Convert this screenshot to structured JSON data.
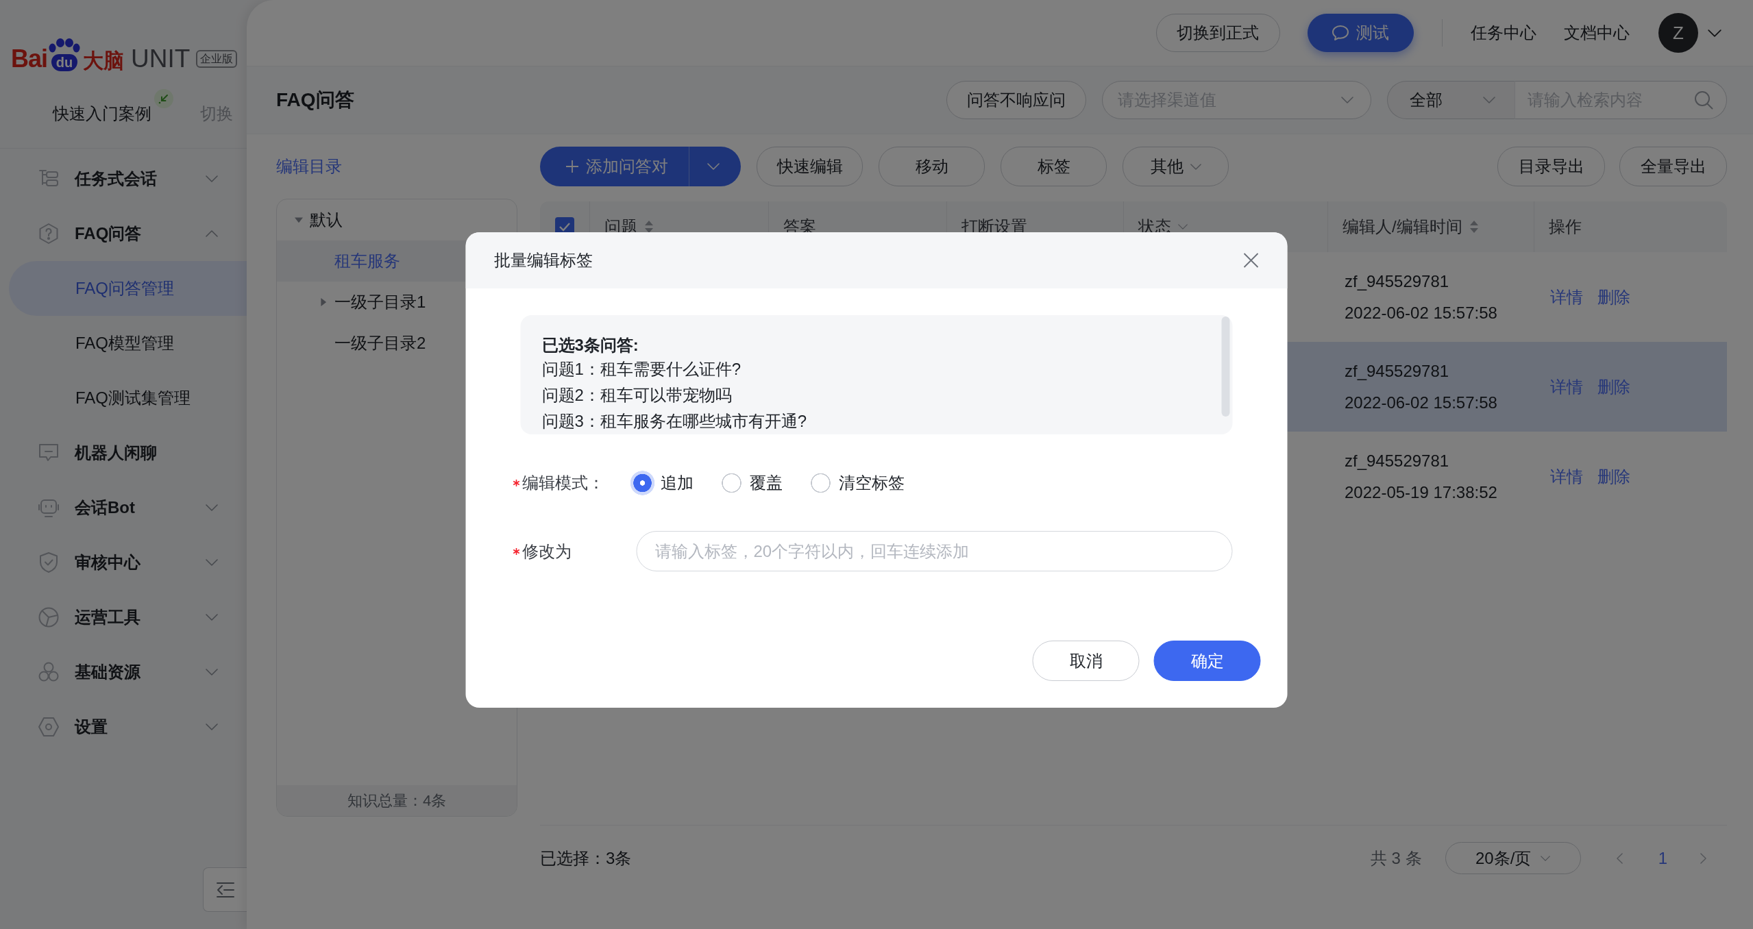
{
  "sidebar": {
    "logo": {
      "brand": "Bai",
      "paw": "du",
      "brain": "大脑",
      "product": "UNIT",
      "edition": "企业版"
    },
    "quick_start": {
      "label": "快速入门案例",
      "switch": "切换"
    },
    "menu": [
      {
        "label": "任务式会话",
        "kind": "group",
        "expanded": false,
        "selected": false
      },
      {
        "label": "FAQ问答",
        "kind": "group",
        "expanded": true,
        "selected": false,
        "children": [
          {
            "label": "FAQ问答管理",
            "selected": true
          },
          {
            "label": "FAQ模型管理",
            "selected": false
          },
          {
            "label": "FAQ测试集管理",
            "selected": false
          }
        ]
      },
      {
        "label": "机器人闲聊",
        "kind": "link",
        "selected": false
      },
      {
        "label": "会话Bot",
        "kind": "group",
        "expanded": false,
        "selected": false
      },
      {
        "label": "审核中心",
        "kind": "group",
        "expanded": false,
        "selected": false
      },
      {
        "label": "运营工具",
        "kind": "group",
        "expanded": false,
        "selected": false
      },
      {
        "label": "基础资源",
        "kind": "group",
        "expanded": false,
        "selected": false
      },
      {
        "label": "设置",
        "kind": "group",
        "expanded": false,
        "selected": false
      }
    ]
  },
  "top_bar": {
    "switch_button": "切换到正式",
    "test_button": "测试",
    "links": [
      "任务中心",
      "文档中心"
    ],
    "avatar": "Z"
  },
  "page_header": {
    "title": "FAQ问答",
    "no_response_button": "问答不响应问",
    "channel_select": {
      "placeholder": "请选择渠道值"
    },
    "search": {
      "scope": "全部",
      "placeholder": "请输入检索内容"
    }
  },
  "toolbar": {
    "edit_catalog_link": "编辑目录",
    "add_button": "添加问答对",
    "buttons": [
      {
        "label": "快速编辑",
        "kind": "plain"
      },
      {
        "label": "移动",
        "kind": "plain"
      },
      {
        "label": "标签",
        "kind": "plain"
      },
      {
        "label": "其他",
        "kind": "dropdown"
      }
    ],
    "export_buttons": [
      "目录导出",
      "全量导出"
    ]
  },
  "tree": {
    "items": [
      {
        "label": "默认",
        "expanded": true,
        "selected": false,
        "children": [
          {
            "label": "租车服务",
            "selected": true
          },
          {
            "label": "一级子目录1",
            "expanded": false,
            "selected": false
          },
          {
            "label": "一级子目录2",
            "selected": false
          }
        ]
      }
    ],
    "footer": "知识总量：4条"
  },
  "table": {
    "all_checked": true,
    "columns": [
      {
        "label": "问题",
        "kind": "sort"
      },
      {
        "label": "答案",
        "kind": "plain"
      },
      {
        "label": "打断设置",
        "kind": "plain"
      },
      {
        "label": "状态",
        "kind": "filter"
      },
      {
        "label": "编辑人/编辑时间",
        "kind": "sort"
      },
      {
        "label": "操作",
        "kind": "plain"
      }
    ],
    "rows": [
      {
        "highlighted": false,
        "editor": "zf_945529781",
        "edited_at": "2022-06-02 15:57:58",
        "actions": [
          "详情",
          "删除"
        ]
      },
      {
        "highlighted": true,
        "editor": "zf_945529781",
        "edited_at": "2022-06-02 15:57:58",
        "actions": [
          "详情",
          "删除"
        ]
      },
      {
        "highlighted": false,
        "editor": "zf_945529781",
        "edited_at": "2022-05-19 17:38:52",
        "actions": [
          "详情",
          "删除"
        ]
      }
    ]
  },
  "footer": {
    "selected_count": "已选择：3条",
    "total": "共 3 条",
    "page_size": "20条/页",
    "pages": [
      {
        "label": "1",
        "selected": true
      }
    ]
  },
  "modal": {
    "title": "批量编辑标签",
    "summary": {
      "heading": "已选3条问答:",
      "lines": [
        "问题1：租车需要什么证件?",
        "问题2：租车可以带宠物吗",
        "问题3：租车服务在哪些城市有开通?"
      ]
    },
    "mode": {
      "label": "编辑模式：",
      "required": true,
      "options": [
        {
          "label": "追加",
          "selected": true
        },
        {
          "label": "覆盖",
          "selected": false
        },
        {
          "label": "清空标签",
          "selected": false
        }
      ]
    },
    "tags_field": {
      "label": "修改为",
      "required": true,
      "placeholder": "请输入标签，20个字符以内，回车连续添加"
    },
    "buttons": [
      {
        "label": "取消",
        "kind": "secondary"
      },
      {
        "label": "确定",
        "kind": "primary"
      }
    ]
  }
}
